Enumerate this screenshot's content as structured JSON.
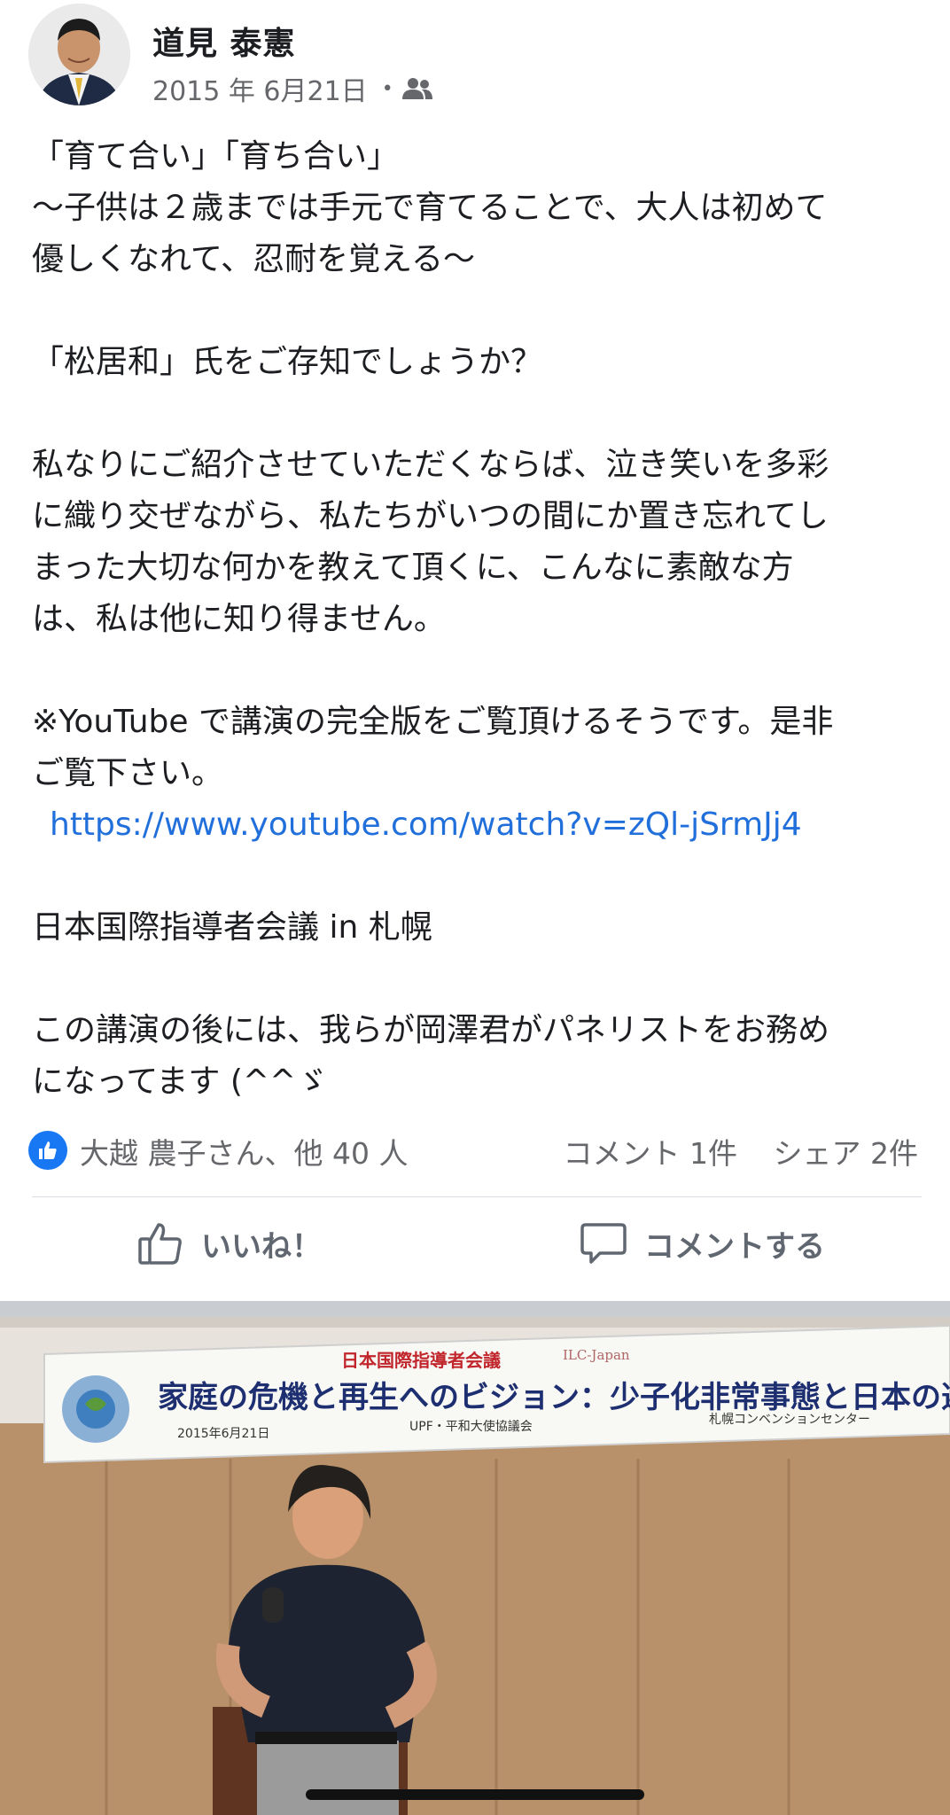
{
  "post": {
    "author": "道見 泰憲",
    "date": "2015 年 6月21日",
    "audience_icon": "friends-icon",
    "body": {
      "line1": "「育て合い」「育ち合い」",
      "line2": "〜子供は２歳までは手元で育てることで、大人は初めて",
      "line3": "優しくなれて、忍耐を覚える〜",
      "para2": "「松居和」氏をご存知でしょうか？",
      "para3_l1": "私なりにご紹介させていただくならば、泣き笑いを多彩",
      "para3_l2": "に織り交ぜながら、私たちがいつの間にか置き忘れてし",
      "para3_l3": "まった大切な何かを教えて頂くに、こんなに素敵な方",
      "para3_l4": "は、私は他に知り得ません。",
      "para4_l1": "※YouTube で講演の完全版をご覧頂けるそうです。是非",
      "para4_l2": "ご覧下さい。",
      "link": "https://www.youtube.com/watch?v=zQl-jSrmJj4",
      "para5": "日本国際指導者会議 in 札幌",
      "para6_l1": "この講演の後には、我らが岡澤君がパネリストをお務め",
      "para6_l2": "になってます (^^ゞ"
    },
    "reactions": {
      "summary": "大越 農子さん、他 40 人",
      "comments": "コメント 1件",
      "shares": "シェア 2件"
    },
    "actions": {
      "like": "いいね！",
      "comment": "コメントする"
    },
    "colors": {
      "link": "#216fdb",
      "accent": "#1877f2",
      "secondary_text": "#65676b"
    }
  },
  "photo": {
    "banner_top": "日本国際指導者会議",
    "banner_tag": "ILC-Japan",
    "banner_main": "家庭の危機と再生へのビジョン：少子化非常事態と日本の選択",
    "banner_date": "2015年6月21日",
    "banner_org": "UPF・平和大使協議会",
    "banner_venue": "札幌コンベンションセンター"
  }
}
